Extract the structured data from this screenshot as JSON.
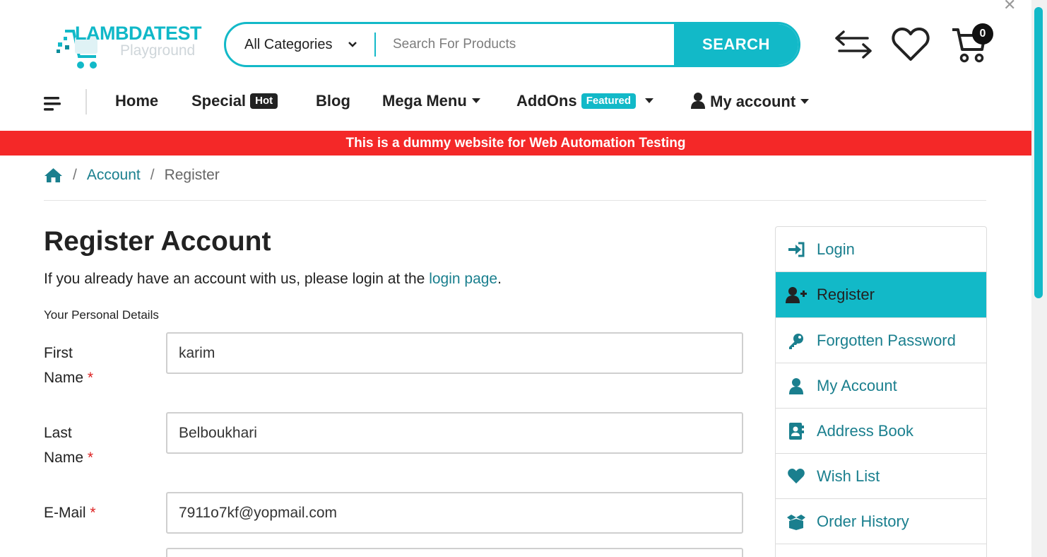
{
  "logo": {
    "line1": "LAMBDATEST",
    "line2": "Playground"
  },
  "search": {
    "category": "All Categories",
    "placeholder": "Search For Products",
    "button": "SEARCH"
  },
  "header": {
    "cart_count": "0"
  },
  "nav": {
    "items": [
      {
        "label": "Home"
      },
      {
        "label": "Special",
        "badge": "Hot"
      },
      {
        "label": "Blog"
      },
      {
        "label": "Mega Menu"
      },
      {
        "label": "AddOns",
        "badge": "Featured"
      },
      {
        "label": "My account"
      }
    ]
  },
  "banner": "This is a dummy website for Web Automation Testing",
  "breadcrumb": {
    "items": [
      "Account",
      "Register"
    ],
    "sep": "/"
  },
  "page": {
    "title": "Register Account",
    "intro_prefix": "If you already have an account with us, please login at the ",
    "intro_link": "login page",
    "intro_suffix": ".",
    "legend": "Your Personal Details"
  },
  "form": {
    "first_name": {
      "label1": "First",
      "label2": "Name",
      "value": "karim"
    },
    "last_name": {
      "label1": "Last",
      "label2": "Name",
      "value": "Belboukhari"
    },
    "email": {
      "label": "E-Mail",
      "value": "7911o7kf@yopmail.com"
    },
    "required_mark": "*"
  },
  "sidebar": {
    "items": [
      {
        "label": "Login",
        "icon": "sign-in-icon"
      },
      {
        "label": "Register",
        "icon": "user-plus-icon",
        "active": true
      },
      {
        "label": "Forgotten Password",
        "icon": "key-icon"
      },
      {
        "label": "My Account",
        "icon": "user-icon"
      },
      {
        "label": "Address Book",
        "icon": "address-book-icon"
      },
      {
        "label": "Wish List",
        "icon": "heart-icon"
      },
      {
        "label": "Order History",
        "icon": "box-open-icon"
      }
    ]
  },
  "colors": {
    "accent": "#12b9c8",
    "link": "#1a7f8e",
    "banner": "#f42828"
  }
}
